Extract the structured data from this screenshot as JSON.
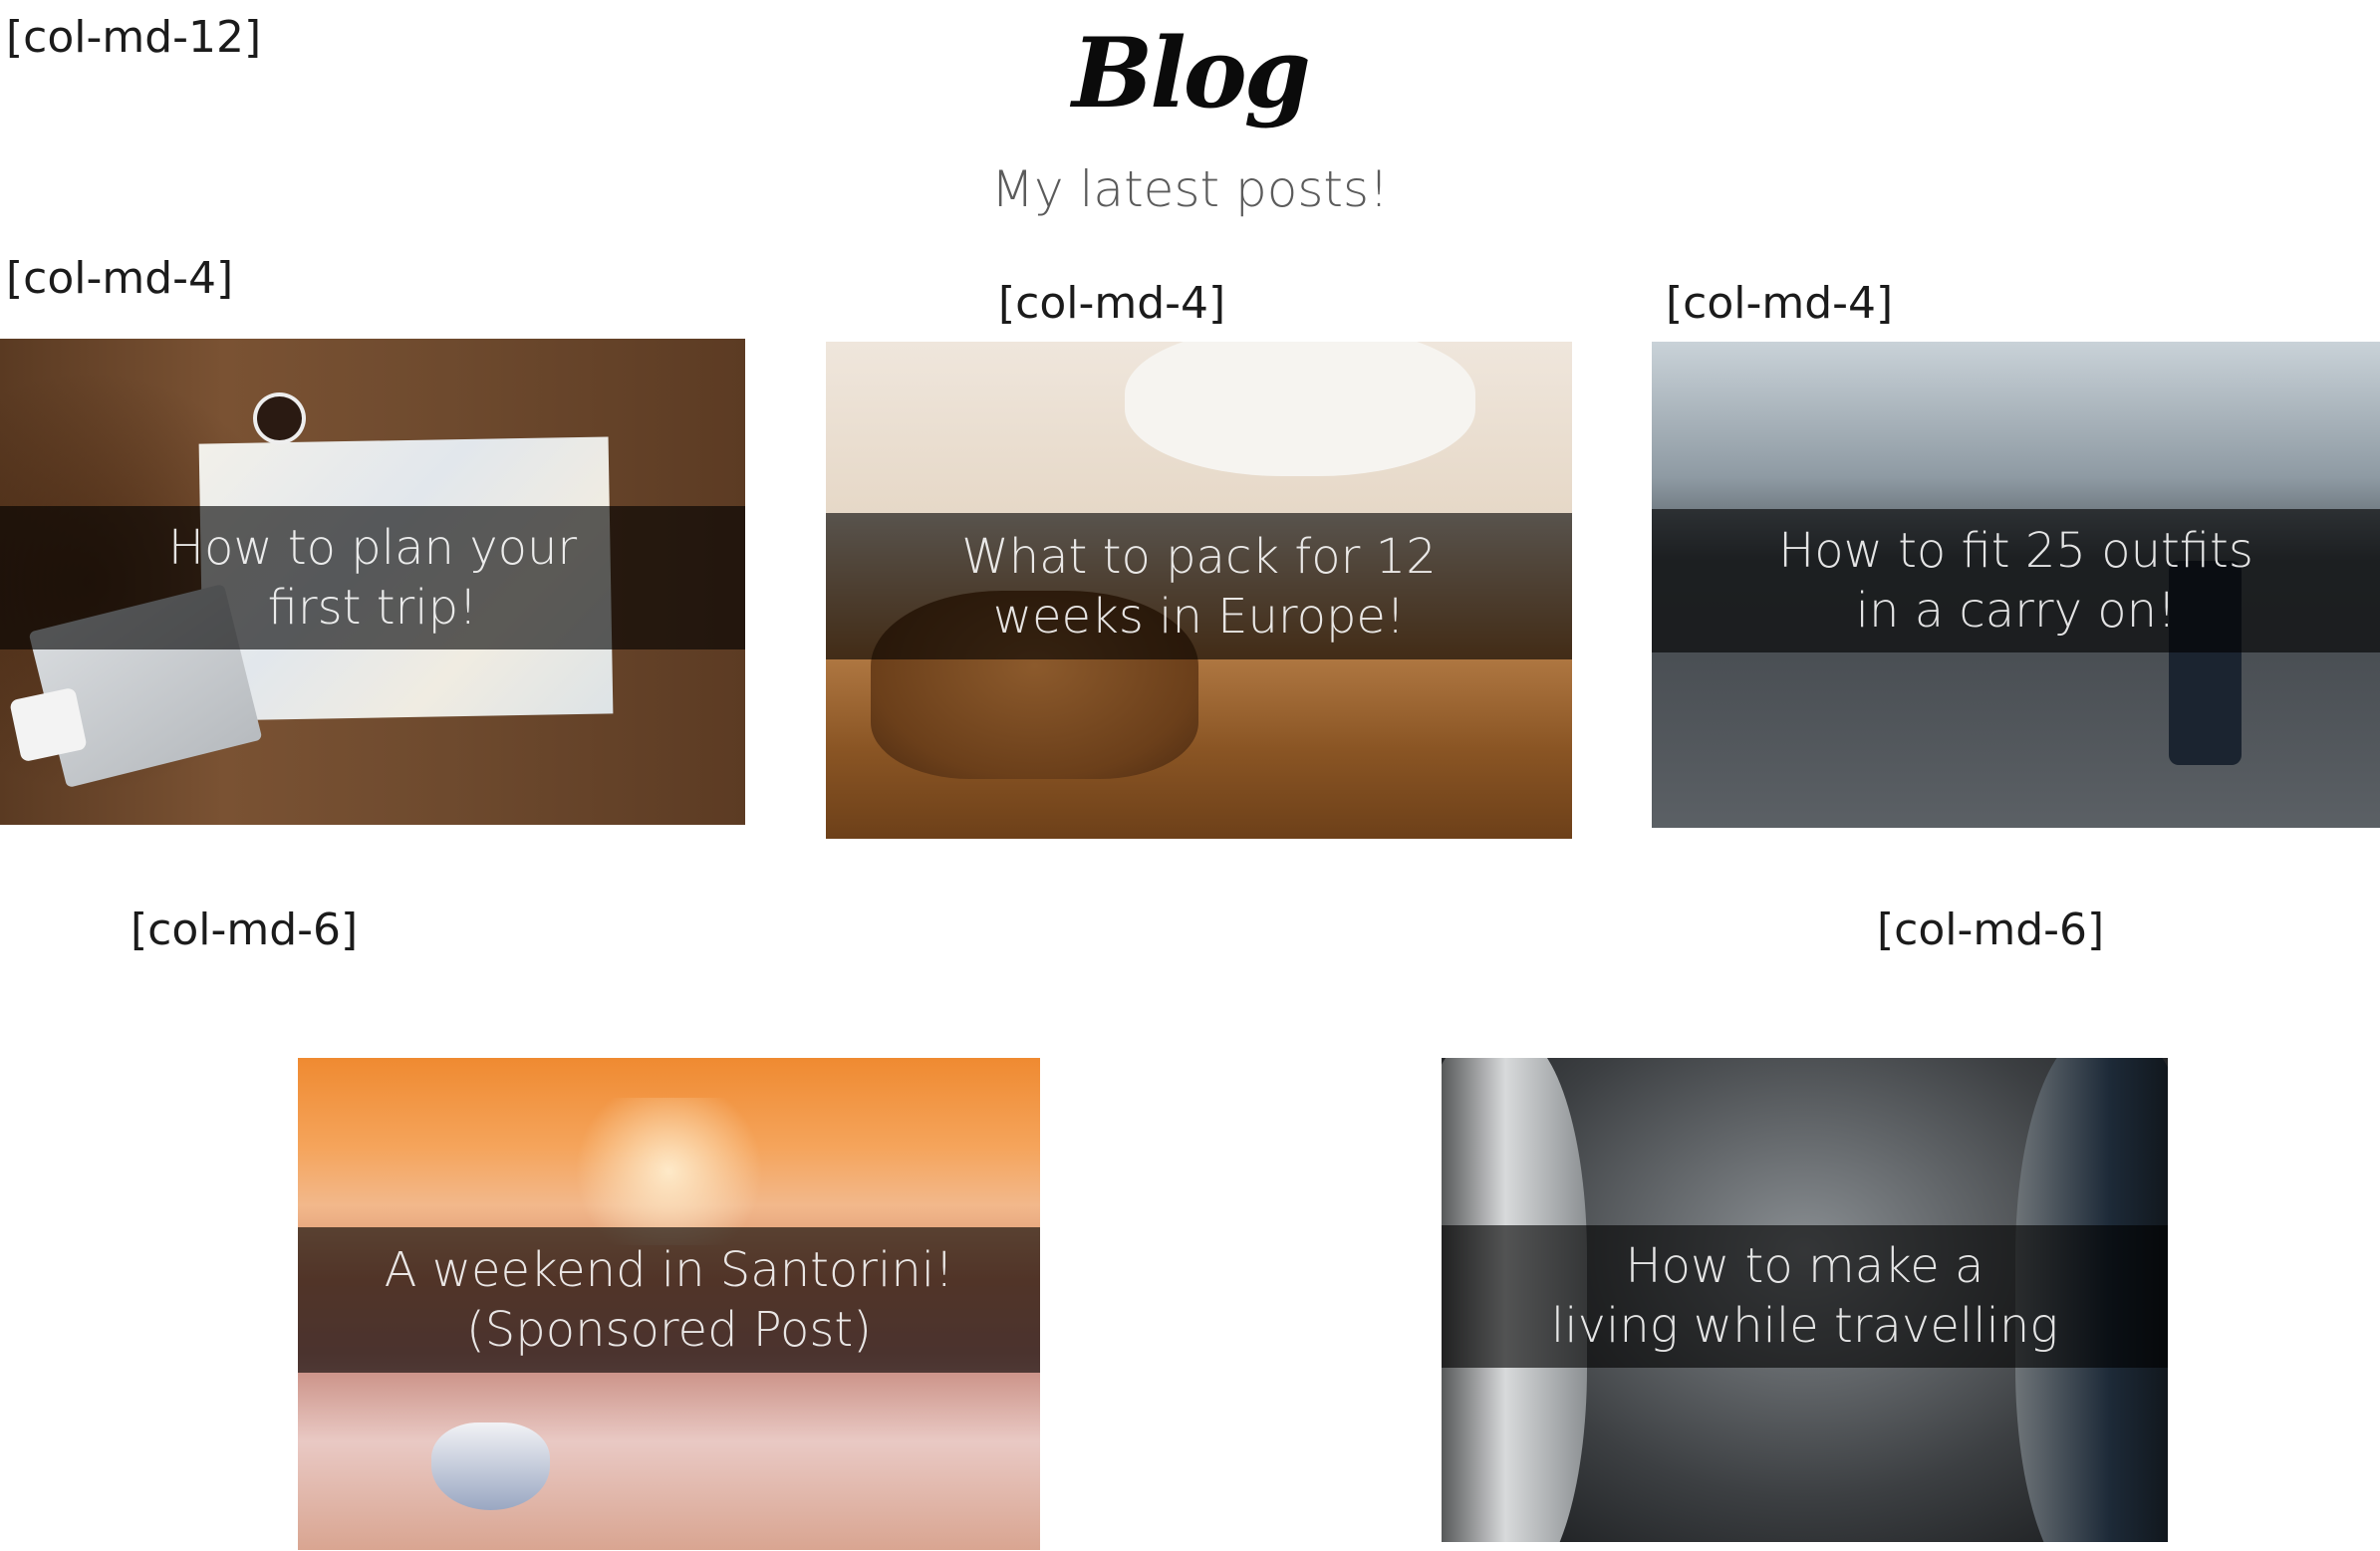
{
  "grid_labels": {
    "header": "[col-md-12]",
    "row1_col1": "[col-md-4]",
    "row1_col2": "[col-md-4]",
    "row1_col3": "[col-md-4]",
    "row2_col1": "[col-md-6]",
    "row2_col2": "[col-md-6]"
  },
  "header": {
    "title": "Blog",
    "subtitle": "My latest posts!"
  },
  "posts": [
    {
      "title": "How to plan your\nfirst trip!"
    },
    {
      "title": "What to pack for 12\nweeks in Europe!"
    },
    {
      "title": "How to fit 25 outfits\nin a carry on!"
    },
    {
      "title": "A weekend in Santorini!\n(Sponsored Post)"
    },
    {
      "title": "How to make a\nliving while travelling"
    }
  ],
  "colors": {
    "background": "#ffffff",
    "overlay_band": "rgba(0,0,0,0.62)",
    "overlay_text": "#ffffff",
    "subtitle": "#5b5b5b"
  }
}
